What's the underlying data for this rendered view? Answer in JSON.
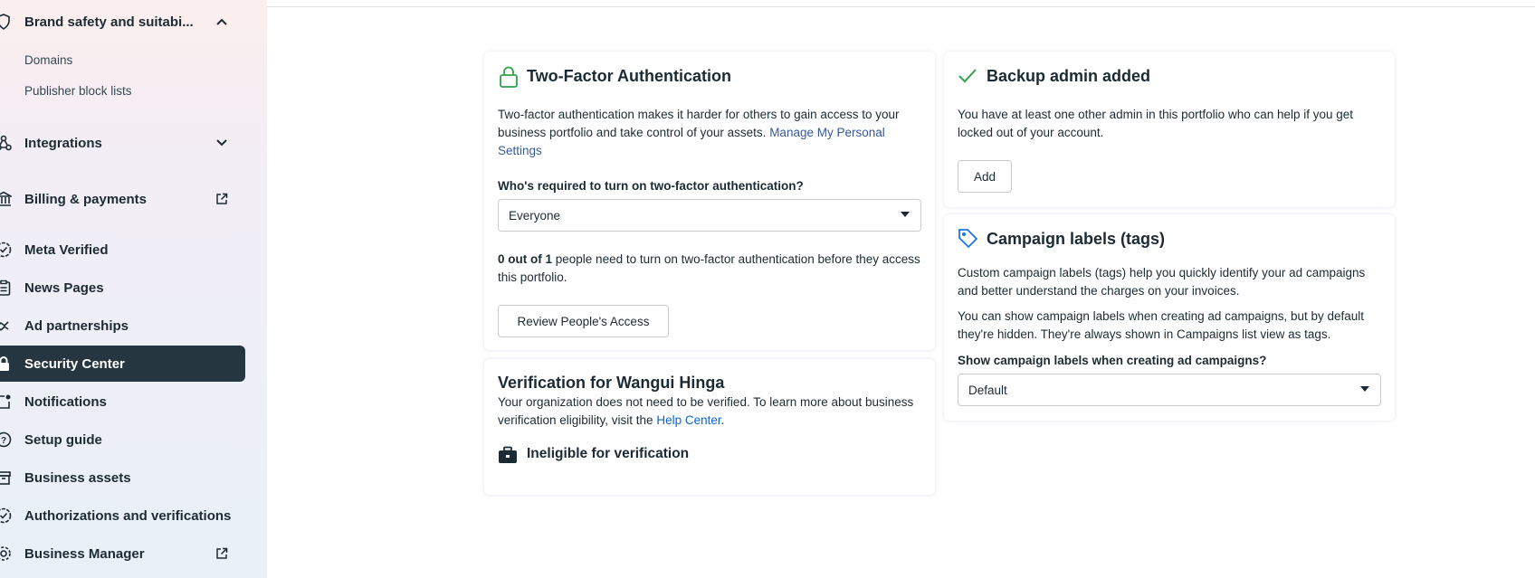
{
  "sidebar": {
    "brand_safety": "Brand safety and suitabi...",
    "sub_items": [
      "Domains",
      "Publisher block lists"
    ],
    "integrations": "Integrations",
    "billing": "Billing & payments",
    "meta_verified": "Meta Verified",
    "news_pages": "News Pages",
    "ad_partnerships": "Ad partnerships",
    "security_center": "Security Center",
    "notifications": "Notifications",
    "setup_guide": "Setup guide",
    "business_assets": "Business assets",
    "authorizations": "Authorizations and verifications",
    "business_manager": "Business Manager"
  },
  "tfa": {
    "title": "Two-Factor Authentication",
    "desc": "Two-factor authentication makes it harder for others to gain access to your business portfolio and take control of your assets.",
    "link": "Manage My Personal Settings",
    "question": "Who's required to turn on two-factor authentication?",
    "select_value": "Everyone",
    "count": "0 out of 1",
    "count_rest": "people need to turn on two-factor authentication before they access this portfolio.",
    "review_button": "Review People's Access"
  },
  "verification": {
    "title": "Verification for Wangui Hinga",
    "desc": "Your organization does not need to be verified. To learn more about business verification eligibility, visit the",
    "link": "Help Center",
    "period": ".",
    "status": "Ineligible for verification"
  },
  "backup": {
    "title": "Backup admin added",
    "desc": "You have at least one other admin in this portfolio who can help if you get locked out of your account.",
    "add_button": "Add"
  },
  "labels": {
    "title": "Campaign labels (tags)",
    "desc1": "Custom campaign labels (tags) help you quickly identify your ad campaigns and better understand the charges on your invoices.",
    "desc2": "You can show campaign labels when creating ad campaigns, but by default they're hidden. They're always shown in Campaigns list view as tags.",
    "question": "Show campaign labels when creating ad campaigns?",
    "select_value": "Default"
  },
  "colors": {
    "active_bg": "#253640",
    "success": "#31a24c",
    "link": "#385898",
    "tag_icon": "#1877f2"
  }
}
